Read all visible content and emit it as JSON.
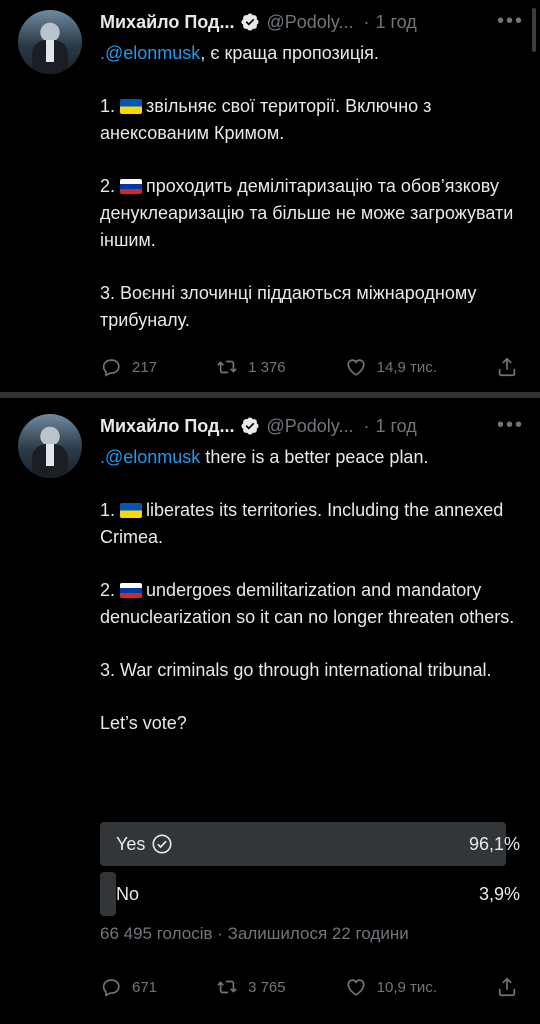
{
  "tweets": [
    {
      "name": "Михайло Под...",
      "handle": "@Podoly...",
      "separator": "·",
      "time": "1 год",
      "more": "•••",
      "mention": ".@elonmusk",
      "intro_rest": ", є краща пропозиція.",
      "point1_num": "1.",
      "point1_text": "звільняє свої території. Включно з анексованим Кримом.",
      "point2_num": "2.",
      "point2_text": "проходить демілітаризацію та обов’язкову денуклеаризацію та більше не може загрожувати іншим.",
      "point3": "3. Воєнні злочинці піддаються міжнародному трибуналу.",
      "replies": "217",
      "retweets": "1 376",
      "likes": "14,9 тис."
    },
    {
      "name": "Михайло Под...",
      "handle": "@Podoly...",
      "separator": "·",
      "time": "1 год",
      "more": "•••",
      "mention": ".@elonmusk",
      "intro_rest": " there is a better peace plan.",
      "point1_num": "1.",
      "point1_text": "liberates its territories. Including the annexed Crimea.",
      "point2_num": "2.",
      "point2_text": "undergoes demilitarization and mandatory denuclearization so it can no longer threaten others.",
      "point3": "3. War criminals go through international tribunal.",
      "question": "Let’s vote?",
      "poll": {
        "options": [
          {
            "label": "Yes",
            "percent": "96,1%",
            "fraction": 0.961,
            "selected": true
          },
          {
            "label": "No",
            "percent": "3,9%",
            "fraction": 0.039,
            "selected": false
          }
        ],
        "meta": "66 495 голосів · Залишилося 22 години"
      },
      "replies": "671",
      "retweets": "3 765",
      "likes": "10,9 тис."
    }
  ],
  "icons": {
    "verified": "verified-badge-icon",
    "reply": "reply-icon",
    "retweet": "retweet-icon",
    "like": "heart-icon",
    "share": "share-icon"
  },
  "colors": {
    "background": "#000000",
    "text": "#e7e9ea",
    "secondary": "#71767b",
    "accent": "#1d9bf0",
    "poll_bar": "#333639"
  }
}
